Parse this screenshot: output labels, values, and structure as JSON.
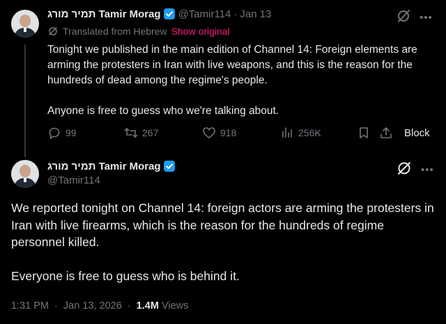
{
  "colors": {
    "background": "#000000",
    "text_primary": "#e7e9ea",
    "text_secondary": "#71767b",
    "verified_blue": "#1d9bf0",
    "show_original_pink": "#f91880",
    "thread_line": "#333639"
  },
  "reply_tweet": {
    "display_name": "תמיר מורג Tamir Morag",
    "handle": "@Tamir114",
    "separator": "·",
    "date": "Jan 13",
    "translated_label": "Translated from Hebrew",
    "show_original_label": "Show original",
    "paragraphs": [
      "Tonight we published in the main edition of Channel 14: Foreign elements are arming the protesters in Iran with live weapons, and this is the reason for the hundreds of dead among the regime's people.",
      "Anyone is free to guess who we're talking about."
    ],
    "stats": {
      "replies": "99",
      "reposts": "267",
      "likes": "918",
      "views": "256K"
    },
    "block_label": "Block",
    "icons": [
      "translate-slash-icon",
      "more-icon",
      "translate-icon",
      "reply-icon",
      "repost-icon",
      "like-icon",
      "views-icon",
      "bookmark-icon",
      "share-icon"
    ]
  },
  "main_tweet": {
    "display_name": "תמיר מורג Tamir Morag",
    "handle": "@Tamir114",
    "paragraphs": [
      "We reported tonight on Channel 14: foreign actors are arming the protesters in Iran with live firearms, which is the reason for the hundreds of regime personnel killed.",
      "Everyone is free to guess who is behind it."
    ],
    "time": "1:31 PM",
    "separator": "·",
    "date": "Jan 13, 2026",
    "views_count": "1.4M",
    "views_label": "Views",
    "icons": [
      "translate-slash-icon",
      "more-icon"
    ]
  }
}
